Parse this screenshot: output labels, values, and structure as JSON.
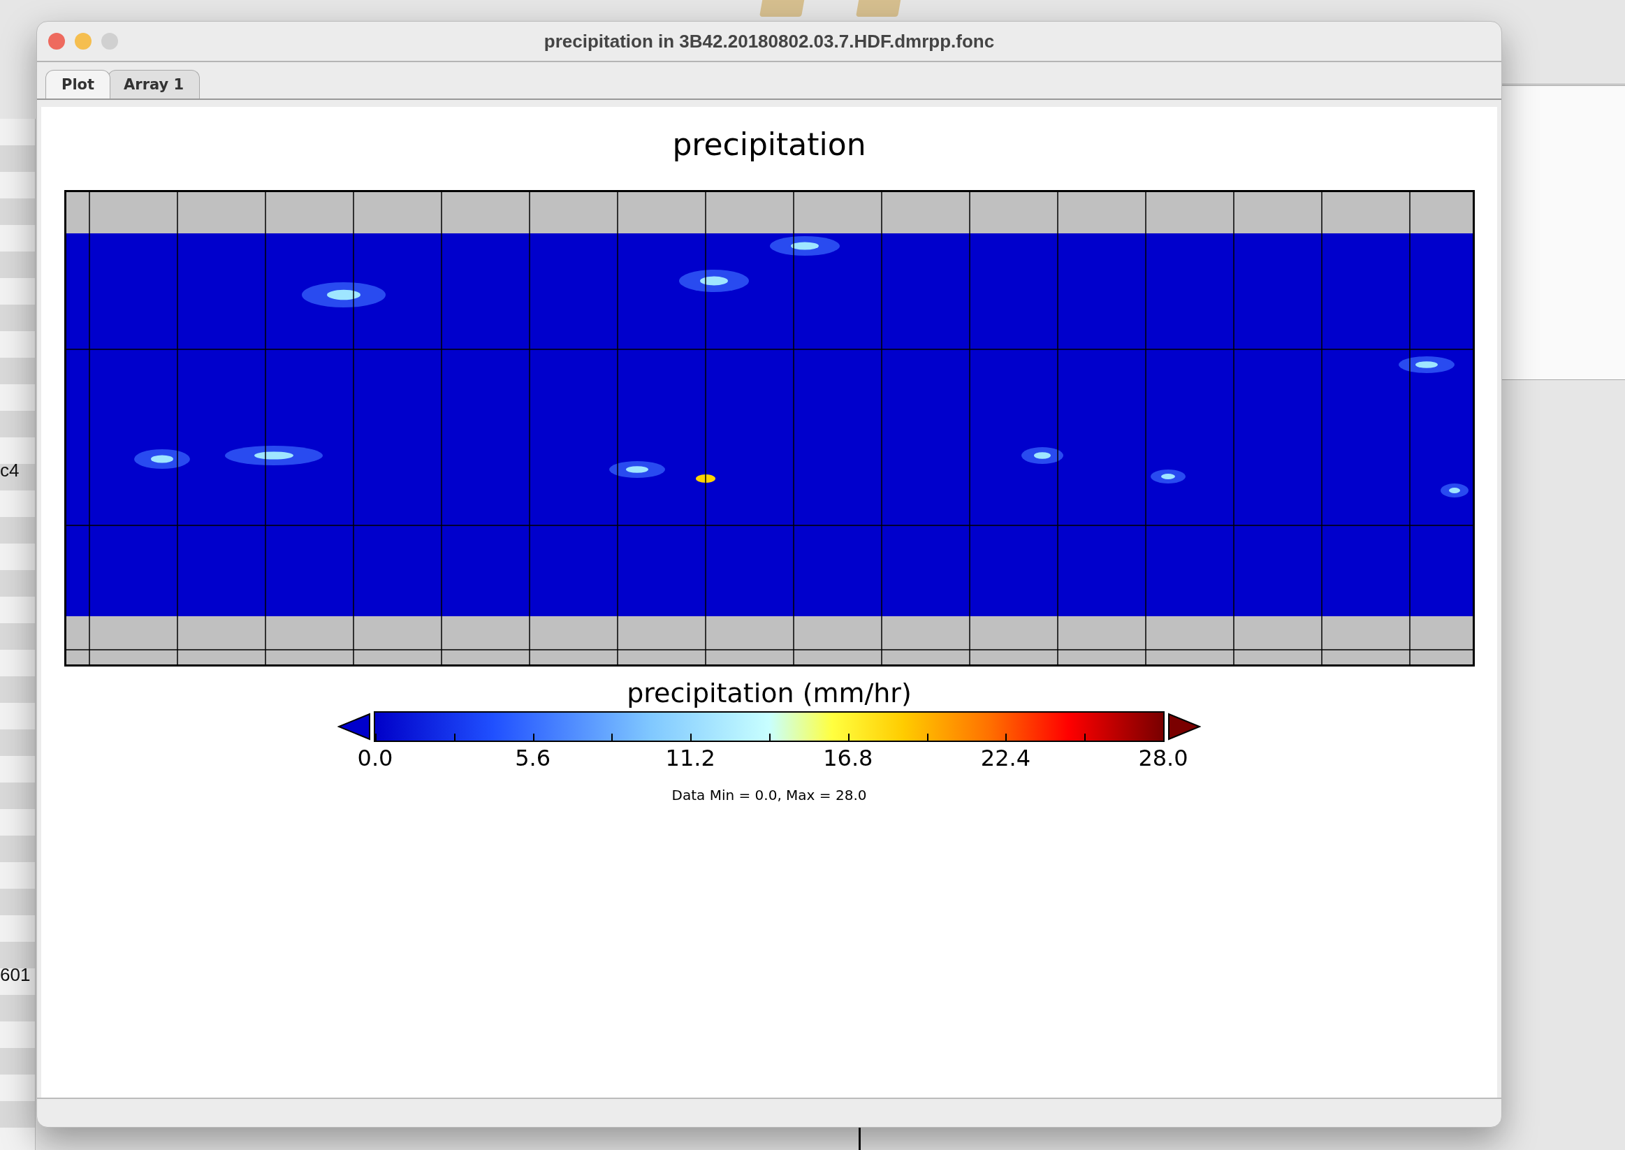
{
  "background": {
    "texts": [
      "c4",
      "601"
    ]
  },
  "window": {
    "title": "precipitation in 3B42.20180802.03.7.HDF.dmrpp.fonc"
  },
  "tabs": [
    {
      "label": "Plot",
      "selected": true
    },
    {
      "label": "Array 1",
      "selected": false
    }
  ],
  "plot": {
    "title": "precipitation",
    "colorbar": {
      "title": "precipitation (mm/hr)",
      "ticks": [
        "0.0",
        "5.6",
        "11.2",
        "16.8",
        "22.4",
        "28.0"
      ]
    },
    "note": "Data Min = 0.0, Max = 28.0"
  }
}
